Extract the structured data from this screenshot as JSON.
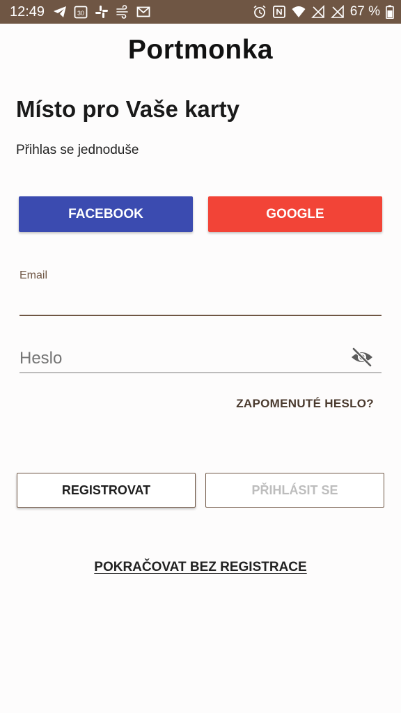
{
  "status_bar": {
    "time": "12:49",
    "calendar_day": "30",
    "battery_percent": "67 %",
    "left_icons": [
      "telegram-icon",
      "calendar-icon",
      "slack-icon",
      "wind-icon",
      "gmail-icon"
    ],
    "right_icons": [
      "alarm-icon",
      "nfc-icon",
      "wifi-icon",
      "signal-icon",
      "signal-icon",
      "battery-icon"
    ]
  },
  "app": {
    "logo": "Portmonka",
    "headline": "Místo pro Vaše karty",
    "subline": "Přihlas se jednoduše"
  },
  "social": {
    "facebook_label": "FACEBOOK",
    "google_label": "GOOGLE",
    "facebook_color": "#3b4bb0",
    "google_color": "#f24437"
  },
  "form": {
    "email_label": "Email",
    "email_value": "",
    "password_placeholder": "Heslo",
    "password_value": "",
    "forgot_label": "ZAPOMENUTÉ HESLO?",
    "password_visibility_icon": "eye-off-icon"
  },
  "actions": {
    "register_label": "REGISTROVAT",
    "login_label": "PŘIHLÁSIT SE",
    "continue_label": "POKRAČOVAT BEZ REGISTRACE"
  },
  "colors": {
    "accent": "#6f5644"
  }
}
